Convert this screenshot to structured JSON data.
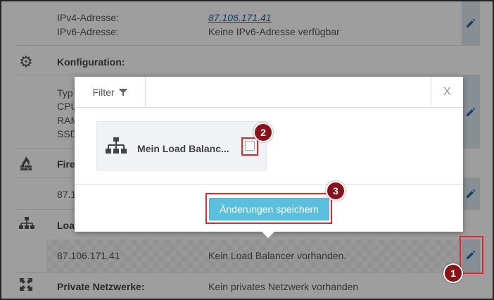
{
  "addresses": {
    "ipv4_label": "IPv4-Adresse:",
    "ipv4_value": "87.106.171.41",
    "ipv6_label": "IPv6-Adresse:",
    "ipv6_value": "Keine IPv6-Adresse verfügbar"
  },
  "configuration": {
    "title": "Konfiguration:",
    "labels": [
      "Typ",
      "CPU",
      "RAM",
      "SSD"
    ]
  },
  "firewall": {
    "title": "Fire",
    "ip": "87.1"
  },
  "load_balancer": {
    "title": "Loa",
    "ip": "87.106.171.41",
    "value": "Kein Load Balancer vorhanden."
  },
  "private_networks": {
    "title": "Private Netzwerke:",
    "value": "Kein privates Netzwerk vorhanden"
  },
  "modal": {
    "filter_label": "Filter",
    "close_label": "X",
    "item_name": "Mein Load Balanc...",
    "save_label": "Änderungen speichern"
  },
  "annotations": {
    "step1": "1",
    "step2": "2",
    "step3": "3"
  },
  "colors": {
    "accent": "#5bc0de",
    "link": "#1a66a8",
    "highlight": "#e3282b",
    "badge": "#8b1118"
  }
}
